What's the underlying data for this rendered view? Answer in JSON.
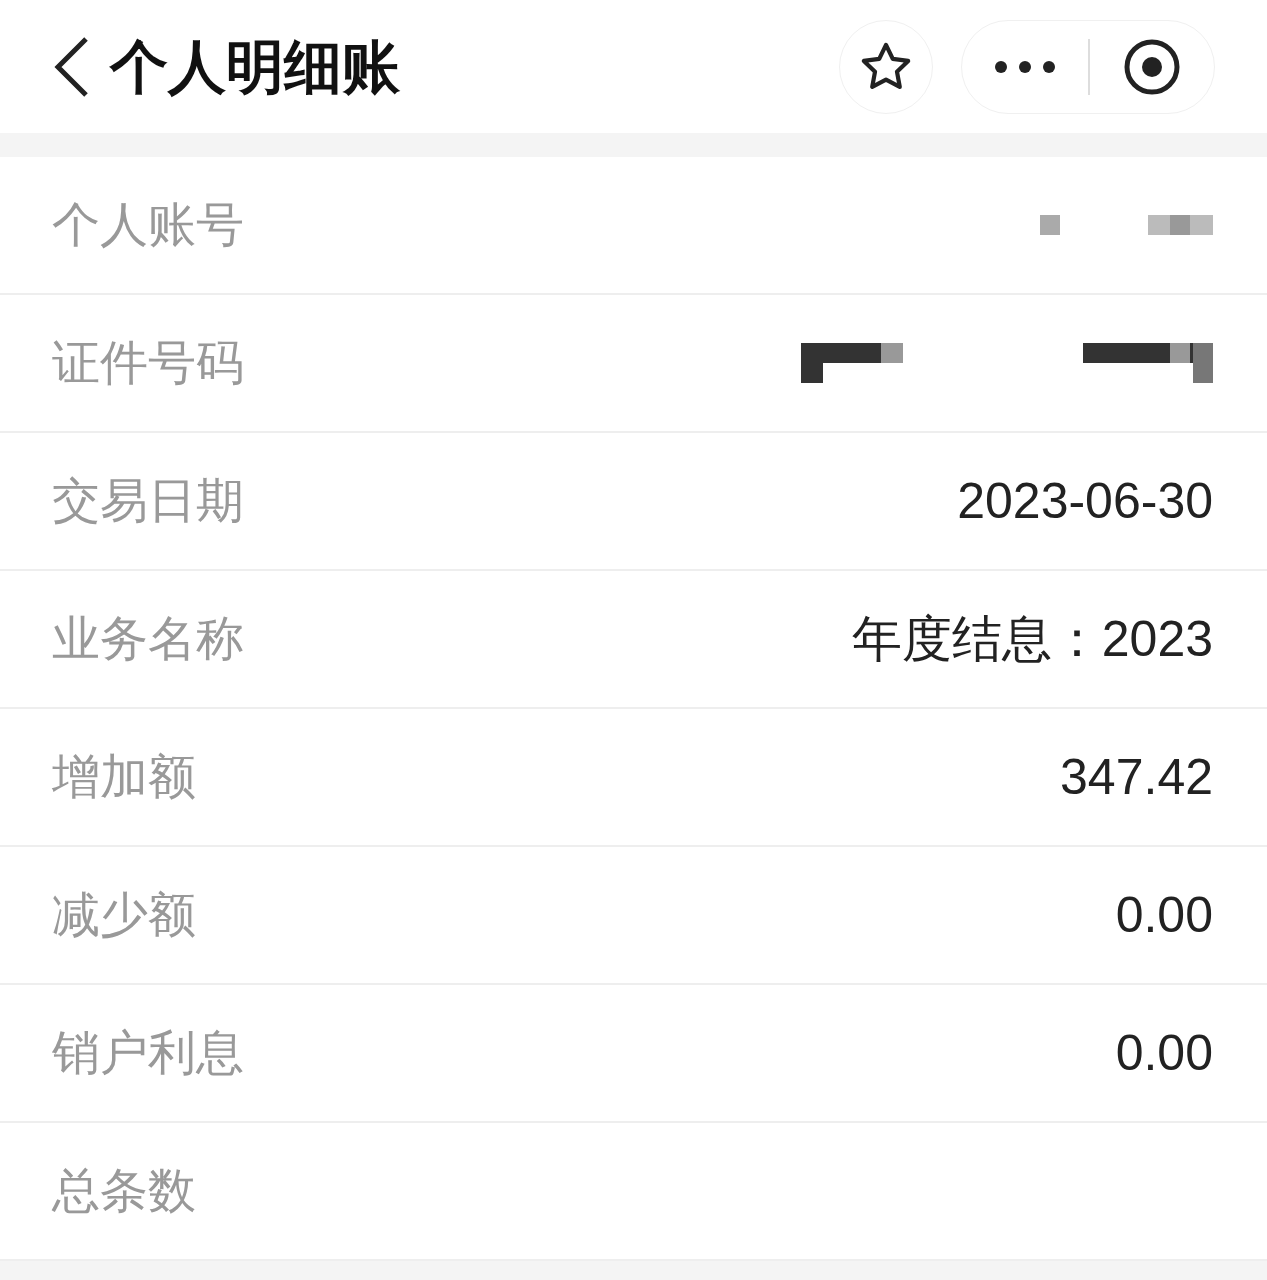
{
  "header": {
    "title": "个人明细账"
  },
  "rows": [
    {
      "label": "个人账号",
      "kind": "redacted"
    },
    {
      "label": "证件号码",
      "kind": "redacted"
    },
    {
      "label": "交易日期",
      "value": "2023-06-30",
      "kind": "text"
    },
    {
      "label": "业务名称",
      "value": "年度结息：2023",
      "kind": "text"
    },
    {
      "label": "增加额",
      "value": "347.42",
      "kind": "text"
    },
    {
      "label": "减少额",
      "value": "0.00",
      "kind": "text"
    },
    {
      "label": "销户利息",
      "value": "0.00",
      "kind": "text"
    },
    {
      "label": "总条数",
      "kind": "text"
    }
  ]
}
